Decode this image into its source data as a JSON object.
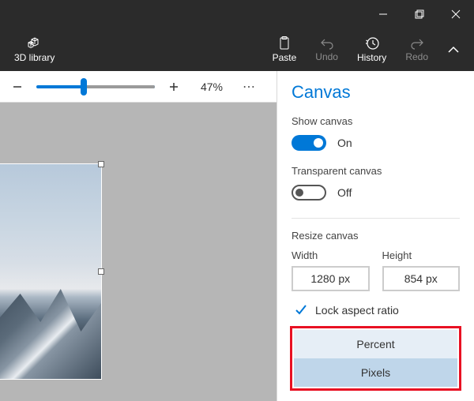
{
  "titlebar": {
    "minimize": "minimize",
    "maximize": "restore",
    "close": "close"
  },
  "ribbon": {
    "library": "3D library",
    "paste": "Paste",
    "undo": "Undo",
    "history": "History",
    "redo": "Redo"
  },
  "zoom": {
    "value": "47%"
  },
  "panel": {
    "title": "Canvas",
    "show_canvas_label": "Show canvas",
    "show_canvas_state": "On",
    "transparent_label": "Transparent canvas",
    "transparent_state": "Off",
    "resize_label": "Resize canvas",
    "width_label": "Width",
    "width_value": "1280 px",
    "height_label": "Height",
    "height_value": "854 px",
    "lock_label": "Lock aspect ratio",
    "unit_percent": "Percent",
    "unit_pixels": "Pixels"
  }
}
